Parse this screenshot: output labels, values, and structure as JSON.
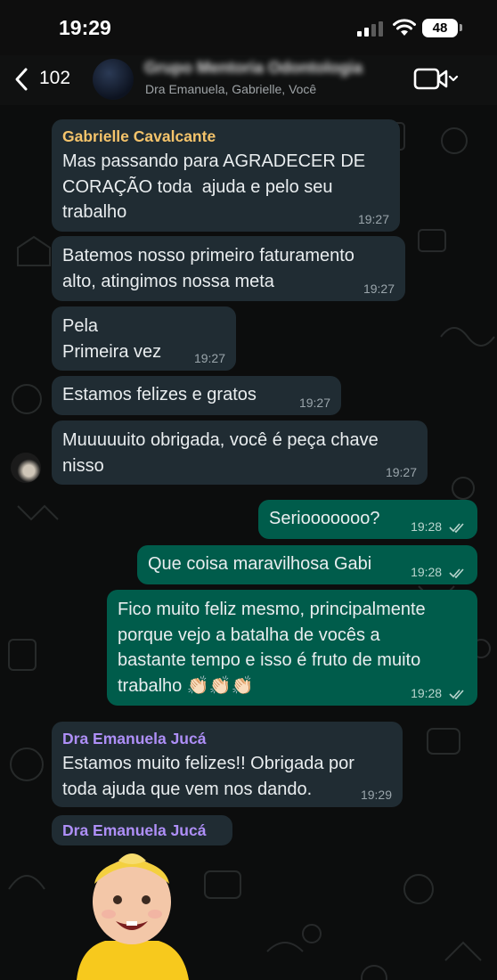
{
  "status_bar": {
    "time": "19:29",
    "battery": "48"
  },
  "header": {
    "back_count": "102",
    "group_name": "Grupo Mentoria Odontologia",
    "participants": "Dra Emanuela, Gabrielle, Você"
  },
  "messages": [
    {
      "sender": "Gabrielle Cavalcante",
      "text": "Mas passando para AGRADECER DE\nCORAÇÃO toda  ajuda e pelo seu\ntrabalho",
      "time": "19:27"
    },
    {
      "text": "Batemos nosso primeiro faturamento\nalto, atingimos nossa meta",
      "time": "19:27"
    },
    {
      "text": "Pela\nPrimeira vez",
      "time": "19:27"
    },
    {
      "text": "Estamos felizes e gratos",
      "time": "19:27"
    },
    {
      "text": "Muuuuuito obrigada, você é peça chave\nnisso",
      "time": "19:27"
    },
    {
      "text": "Seriooooooo?",
      "time": "19:28"
    },
    {
      "text": "Que coisa maravilhosa Gabi",
      "time": "19:28"
    },
    {
      "text": "Fico muito feliz mesmo, principalmente\nporque vejo a batalha de vocês a\nbastante tempo e isso é fruto de muito\ntrabalho 👏🏻👏🏻👏🏻",
      "time": "19:28"
    },
    {
      "sender": "Dra Emanuela Jucá",
      "text": "Estamos muito felizes!! Obrigada por\ntoda ajuda que vem nos dando.",
      "time": "19:29"
    },
    {
      "sender": "Dra Emanuela Jucá"
    }
  ],
  "colors": {
    "incoming_bubble": "#202c33",
    "outgoing_bubble": "#005c4b",
    "sender_gabrielle": "#f5c46b",
    "sender_emanuela": "#ae8ff7"
  }
}
